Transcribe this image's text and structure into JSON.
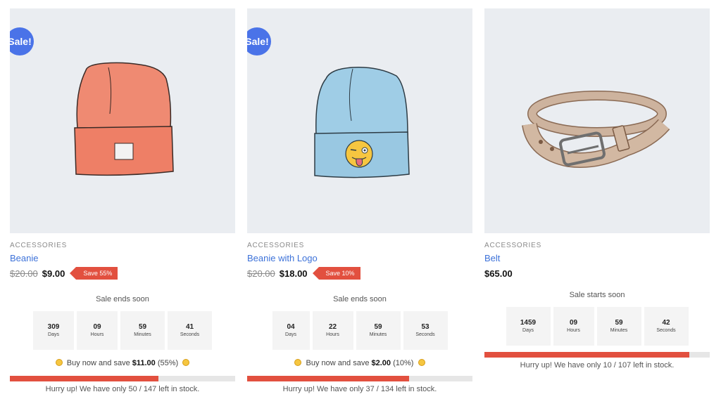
{
  "products": [
    {
      "image": "beanie-illustration",
      "badge": "Sale!",
      "category": "ACCESSORIES",
      "name": "Beanie",
      "old_price": "$20.00",
      "price": "$9.00",
      "save_tag": "Save 55%",
      "sale_label": "Sale ends soon",
      "countdown": [
        {
          "value": "309",
          "label": "Days"
        },
        {
          "value": "09",
          "label": "Hours"
        },
        {
          "value": "59",
          "label": "Minutes"
        },
        {
          "value": "41",
          "label": "Seconds"
        }
      ],
      "savings_prefix": "Buy now and save",
      "savings_amount": "$11.00",
      "savings_suffix": "(55%)",
      "stock_text": "Hurry up! We have only 50 / 147 left in stock.",
      "stock_fraction": 0.66
    },
    {
      "image": "beanie-with-logo-illustration",
      "badge": "Sale!",
      "category": "ACCESSORIES",
      "name": "Beanie with Logo",
      "old_price": "$20.00",
      "price": "$18.00",
      "save_tag": "Save 10%",
      "sale_label": "Sale ends soon",
      "countdown": [
        {
          "value": "04",
          "label": "Days"
        },
        {
          "value": "22",
          "label": "Hours"
        },
        {
          "value": "59",
          "label": "Minutes"
        },
        {
          "value": "53",
          "label": "Seconds"
        }
      ],
      "savings_prefix": "Buy now and save",
      "savings_amount": "$2.00",
      "savings_suffix": "(10%)",
      "stock_text": "Hurry up! We have only 37 / 134 left in stock.",
      "stock_fraction": 0.72
    },
    {
      "image": "belt-illustration",
      "category": "ACCESSORIES",
      "name": "Belt",
      "price": "$65.00",
      "sale_label": "Sale starts soon",
      "countdown": [
        {
          "value": "1459",
          "label": "Days"
        },
        {
          "value": "09",
          "label": "Hours"
        },
        {
          "value": "59",
          "label": "Minutes"
        },
        {
          "value": "42",
          "label": "Seconds"
        }
      ],
      "stock_text": "Hurry up! We have only 10 / 107 left in stock.",
      "stock_fraction": 0.91
    }
  ],
  "colors": {
    "badge": "#4a73e8",
    "link": "#3d72d9",
    "accent_red": "#e2503f",
    "image_bg": "#eaedf1"
  }
}
